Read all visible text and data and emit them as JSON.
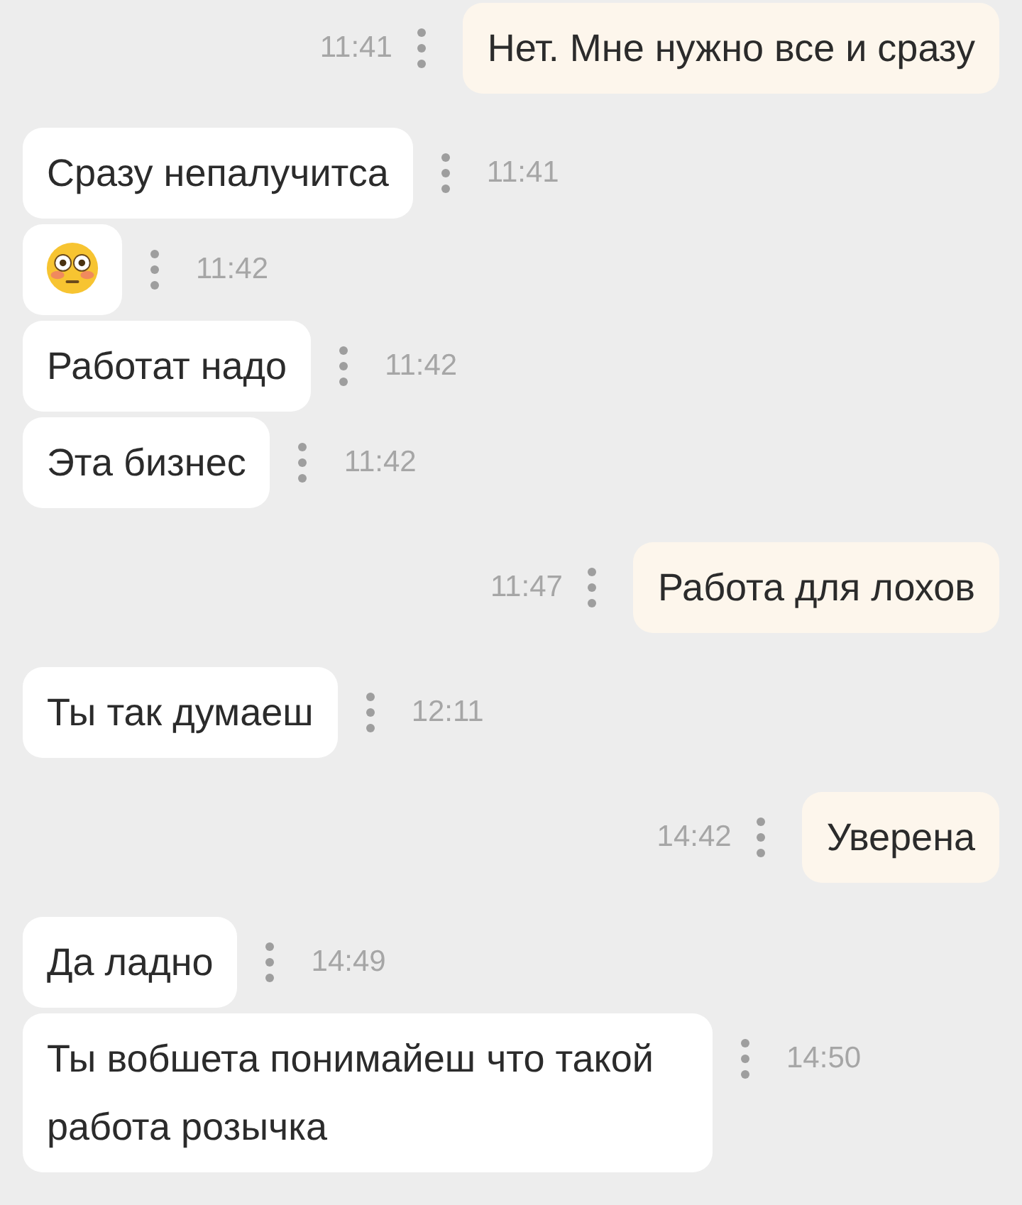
{
  "messages": [
    {
      "kind": "out",
      "text": "Нет. Мне нужно все и сразу",
      "time": "11:41"
    },
    {
      "kind": "in",
      "text": "Сразу непалучитса",
      "time": "11:41"
    },
    {
      "kind": "emoji",
      "time": "11:42"
    },
    {
      "kind": "in",
      "text": "Работат надо",
      "time": "11:42"
    },
    {
      "kind": "in",
      "text": "Эта бизнес",
      "time": "11:42"
    },
    {
      "kind": "out",
      "text": "Работа для лохов",
      "time": "11:47"
    },
    {
      "kind": "in",
      "text": "Ты так думаеш",
      "time": "12:11"
    },
    {
      "kind": "out",
      "text": "Уверена",
      "time": "14:42"
    },
    {
      "kind": "in",
      "text": "Да ладно",
      "time": "14:49"
    },
    {
      "kind": "in",
      "text": "Ты вобшета понимайеш что такой работа розычка",
      "time": "14:50"
    }
  ]
}
